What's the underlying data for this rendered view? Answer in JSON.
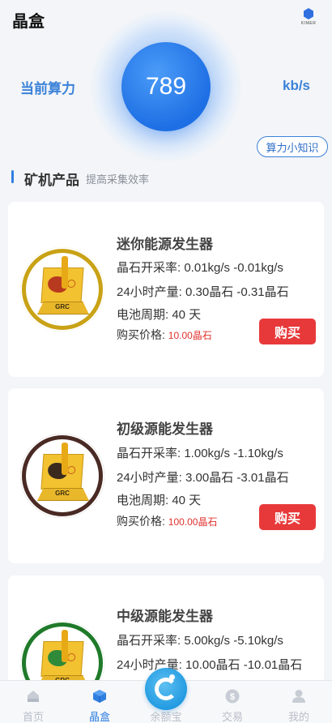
{
  "header": {
    "title": "晶盒",
    "logo_text": "KIMER"
  },
  "hashrate": {
    "label": "当前算力",
    "value": "789",
    "unit": "kb/s"
  },
  "tips_button": "算力小知识",
  "section": {
    "title": "矿机产品",
    "subtitle": "提高采集效率"
  },
  "products": [
    {
      "name": "迷你能源发生器",
      "rate": "晶石开采率: 0.01kg/s -0.01kg/s",
      "output": "24小时产量: 0.30晶石 -0.31晶石",
      "battery": "电池周期: 40 天",
      "price_label": "购买价格: ",
      "price_value": "10.00晶石",
      "buy_label": "购买",
      "ring_color": "#c9a216",
      "blob_color": "#b83a1e",
      "badge_text": "GRC"
    },
    {
      "name": "初级源能发生器",
      "rate": "晶石开采率: 1.00kg/s -1.10kg/s",
      "output": "24小时产量: 3.00晶石 -3.01晶石",
      "battery": "电池周期: 40 天",
      "price_label": "购买价格: ",
      "price_value": "100.00晶石",
      "buy_label": "购买",
      "ring_color": "#4a2a24",
      "blob_color": "#3a2a1e",
      "badge_text": "GRC"
    },
    {
      "name": "中级源能发生器",
      "rate": "晶石开采率: 5.00kg/s -5.10kg/s",
      "output": "24小时产量: 10.00晶石 -10.01晶石",
      "battery": "",
      "price_label": "",
      "price_value": "",
      "buy_label": "",
      "ring_color": "#1f7a2a",
      "blob_color": "#2f8a3a",
      "badge_text": "GRC"
    }
  ],
  "tabbar": {
    "items": [
      {
        "label": "首页",
        "icon": "home-icon",
        "active": false
      },
      {
        "label": "晶盒",
        "icon": "cube-icon",
        "active": true
      },
      {
        "label": "余额宝",
        "icon": "wallet-swirl-icon",
        "active": false
      },
      {
        "label": "交易",
        "icon": "dollar-icon",
        "active": false
      },
      {
        "label": "我的",
        "icon": "user-icon",
        "active": false
      }
    ]
  },
  "colors": {
    "accent": "#2f7fe0",
    "buy": "#e8393a",
    "price": "#e0322f"
  }
}
